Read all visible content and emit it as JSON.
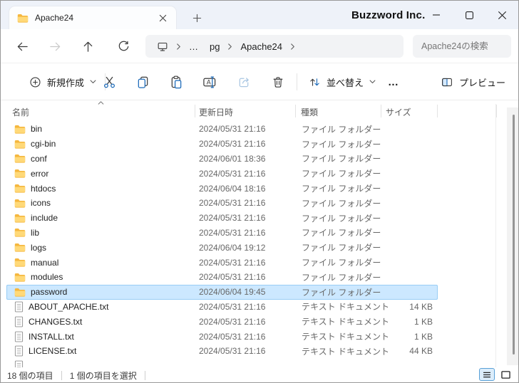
{
  "window": {
    "tab_title": "Apache24",
    "watermark": "Buzzword Inc."
  },
  "nav": {
    "crumb_overflow": "…",
    "crumb_parent": "pg",
    "crumb_current": "Apache24",
    "search_placeholder": "Apache24の検索"
  },
  "toolbar": {
    "new_label": "新規作成",
    "sort_label": "並べ替え",
    "more_label": "…",
    "preview_label": "プレビュー"
  },
  "columns": {
    "name": "名前",
    "date_modified": "更新日時",
    "type": "種類",
    "size": "サイズ"
  },
  "files": {
    "rows": [
      {
        "name": "bin",
        "date": "2024/05/31 21:16",
        "type": "ファイル フォルダー",
        "size": "",
        "kind": "folder",
        "selected": false
      },
      {
        "name": "cgi-bin",
        "date": "2024/05/31 21:16",
        "type": "ファイル フォルダー",
        "size": "",
        "kind": "folder",
        "selected": false
      },
      {
        "name": "conf",
        "date": "2024/06/01 18:36",
        "type": "ファイル フォルダー",
        "size": "",
        "kind": "folder",
        "selected": false
      },
      {
        "name": "error",
        "date": "2024/05/31 21:16",
        "type": "ファイル フォルダー",
        "size": "",
        "kind": "folder",
        "selected": false
      },
      {
        "name": "htdocs",
        "date": "2024/06/04 18:16",
        "type": "ファイル フォルダー",
        "size": "",
        "kind": "folder",
        "selected": false
      },
      {
        "name": "icons",
        "date": "2024/05/31 21:16",
        "type": "ファイル フォルダー",
        "size": "",
        "kind": "folder",
        "selected": false
      },
      {
        "name": "include",
        "date": "2024/05/31 21:16",
        "type": "ファイル フォルダー",
        "size": "",
        "kind": "folder",
        "selected": false
      },
      {
        "name": "lib",
        "date": "2024/05/31 21:16",
        "type": "ファイル フォルダー",
        "size": "",
        "kind": "folder",
        "selected": false
      },
      {
        "name": "logs",
        "date": "2024/06/04 19:12",
        "type": "ファイル フォルダー",
        "size": "",
        "kind": "folder",
        "selected": false
      },
      {
        "name": "manual",
        "date": "2024/05/31 21:16",
        "type": "ファイル フォルダー",
        "size": "",
        "kind": "folder",
        "selected": false
      },
      {
        "name": "modules",
        "date": "2024/05/31 21:16",
        "type": "ファイル フォルダー",
        "size": "",
        "kind": "folder",
        "selected": false
      },
      {
        "name": "password",
        "date": "2024/06/04 19:45",
        "type": "ファイル フォルダー",
        "size": "",
        "kind": "folder",
        "selected": true
      },
      {
        "name": "ABOUT_APACHE.txt",
        "date": "2024/05/31 21:16",
        "type": "テキスト ドキュメント",
        "size": "14 KB",
        "kind": "file",
        "selected": false
      },
      {
        "name": "CHANGES.txt",
        "date": "2024/05/31 21:16",
        "type": "テキスト ドキュメント",
        "size": "1 KB",
        "kind": "file",
        "selected": false
      },
      {
        "name": "INSTALL.txt",
        "date": "2024/05/31 21:16",
        "type": "テキスト ドキュメント",
        "size": "1 KB",
        "kind": "file",
        "selected": false
      },
      {
        "name": "LICENSE.txt",
        "date": "2024/05/31 21:16",
        "type": "テキスト ドキュメント",
        "size": "44 KB",
        "kind": "file",
        "selected": false
      }
    ],
    "partial_row_visible": true
  },
  "statusbar": {
    "item_count": "18 個の項目",
    "selection_count": "1 個の項目を選択"
  },
  "colors": {
    "accent_blue": "#1868b8",
    "selection_bg": "#cce8ff",
    "selection_border": "#98cdf5",
    "titlebar_bg": "#eef2f9",
    "chrome_bg": "#f2f3f5",
    "folder_front": "#ffd978",
    "folder_back": "#f5b73f"
  },
  "icons": {
    "tab-folder-icon": "folder",
    "tab-close-icon": "x",
    "new-tab-icon": "+",
    "minimize-icon": "—",
    "maximize-icon": "□",
    "close-icon": "x",
    "back-icon": "←",
    "forward-icon": "→",
    "up-icon": "↑",
    "refresh-icon": "⟳",
    "this-pc-icon": "monitor",
    "chevron-right-icon": "›",
    "new-item-icon": "⊕",
    "chevron-down-icon": "⌄",
    "cut-icon": "scissors",
    "copy-icon": "two-pages",
    "paste-icon": "clipboard",
    "rename-icon": "a-with-cursor",
    "share-icon": "arrow-out",
    "delete-icon": "trash",
    "sort-icon": "↑↓",
    "preview-icon": "split-pane",
    "sort-ascending-icon": "^",
    "folder-icon": "yellow-folder",
    "text-file-icon": "document-lines",
    "view-details-icon": "≡",
    "view-icons-icon": "□"
  }
}
